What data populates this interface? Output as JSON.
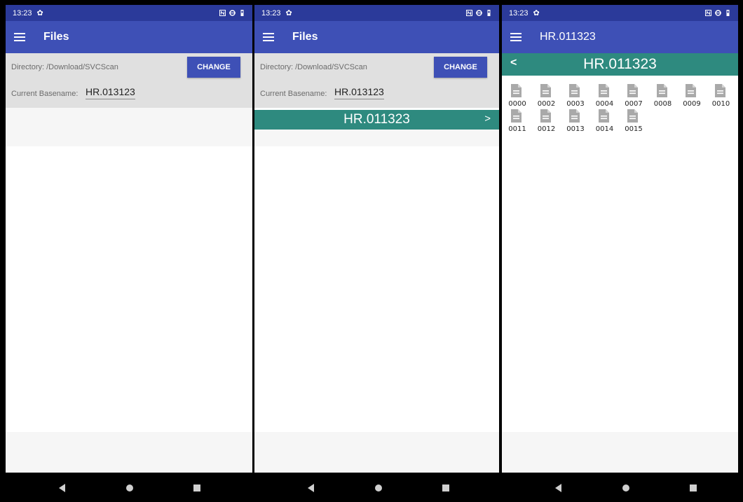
{
  "screens": [
    {
      "status": {
        "time": "13:23"
      },
      "appbar": {
        "title": "Files"
      },
      "directory": {
        "label": "Directory:  /Download/SVCScan",
        "change_button": "CHANGE"
      },
      "basename": {
        "label": "Current Basename:",
        "value": "HR.013123"
      }
    },
    {
      "status": {
        "time": "13:23"
      },
      "appbar": {
        "title": "Files"
      },
      "directory": {
        "label": "Directory:  /Download/SVCScan",
        "change_button": "CHANGE"
      },
      "basename": {
        "label": "Current Basename:",
        "value": "HR.013123"
      },
      "folder": {
        "name": "HR.011323",
        "chevron": ">"
      }
    },
    {
      "status": {
        "time": "13:23"
      },
      "appbar": {
        "title": "HR.011323"
      },
      "header": {
        "title": "HR.011323",
        "back": "<"
      },
      "files": [
        "0000",
        "0002",
        "0003",
        "0004",
        "0007",
        "0008",
        "0009",
        "0010",
        "0011",
        "0012",
        "0013",
        "0014",
        "0015"
      ]
    }
  ],
  "colors": {
    "statusbar": "#2b3a9a",
    "appbar": "#3e50b6",
    "accent_teal": "#2e8a7f",
    "controls_bg": "#e0e0e0"
  },
  "icons": {
    "menu": "hamburger-menu-icon",
    "settings": "gear-icon",
    "file": "document-icon"
  }
}
